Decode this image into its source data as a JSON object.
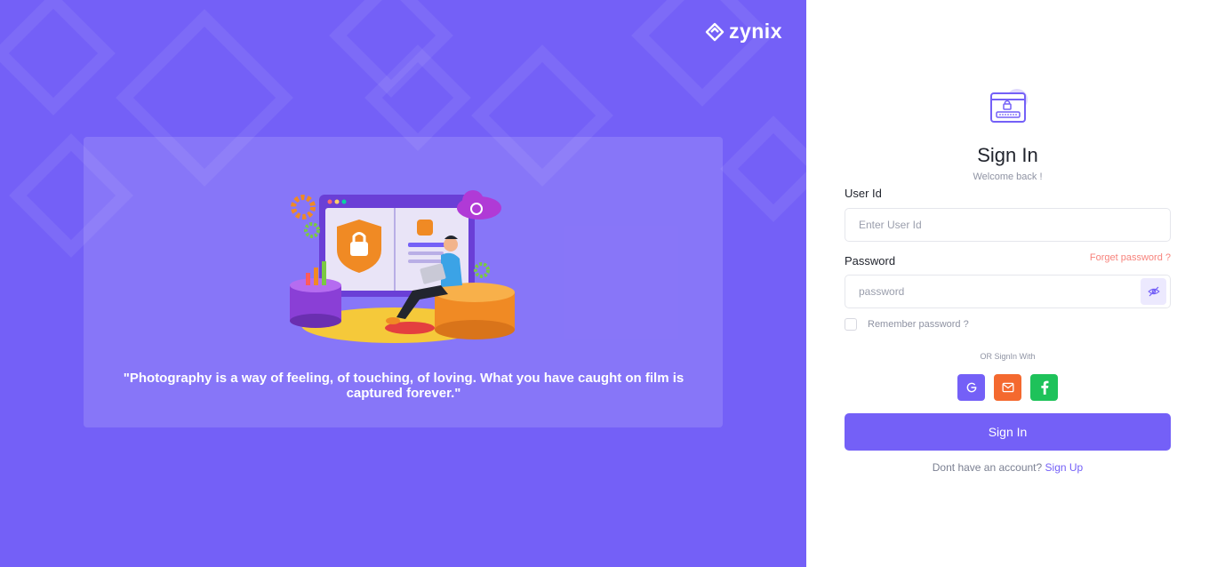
{
  "brand": {
    "name": "zynix"
  },
  "banner": {
    "quote": "\"Photography is a way of feeling, of touching, of loving. What you have caught on film is captured forever.\""
  },
  "form": {
    "title": "Sign In",
    "subtitle": "Welcome back !",
    "user_id": {
      "label": "User Id",
      "placeholder": "Enter User Id",
      "value": ""
    },
    "password": {
      "label": "Password",
      "placeholder": "password",
      "value": "",
      "toggle_icon": "eye-off-icon"
    },
    "forgot_link": "Forget password ?",
    "remember": {
      "label": "Remember password ?",
      "checked": false
    },
    "social": {
      "heading": "OR SignIn With",
      "buttons": [
        {
          "name": "google",
          "icon": "google-icon",
          "color": "#7460f7"
        },
        {
          "name": "mail",
          "icon": "mail-icon",
          "color": "#f4692f"
        },
        {
          "name": "facebook",
          "icon": "facebook-icon",
          "color": "#1ec25a"
        }
      ]
    },
    "submit_label": "Sign In",
    "signup_prompt": "Dont have an account?",
    "signup_link": "Sign Up"
  },
  "colors": {
    "primary": "#7460f7",
    "danger": "#f7837c",
    "text": "#22252e",
    "muted": "#8f93a3"
  }
}
